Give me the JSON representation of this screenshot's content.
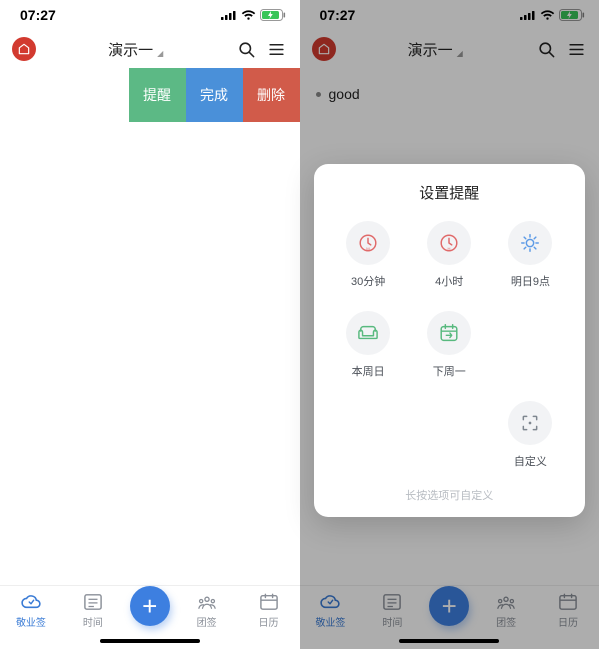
{
  "status": {
    "time": "07:27"
  },
  "nav": {
    "title": "演示一"
  },
  "swipe": {
    "remind": "提醒",
    "done": "完成",
    "delete": "删除"
  },
  "list": {
    "item1": "good"
  },
  "tabs": {
    "t1": "敬业签",
    "t2": "时间",
    "t3": "团签",
    "t4": "日历"
  },
  "modal": {
    "title": "设置提醒",
    "hint": "长按选项可自定义",
    "opts": {
      "o1": "30分钟",
      "o2": "4小时",
      "o3": "明日9点",
      "o4": "本周日",
      "o5": "下周一",
      "o6": "自定义"
    }
  }
}
